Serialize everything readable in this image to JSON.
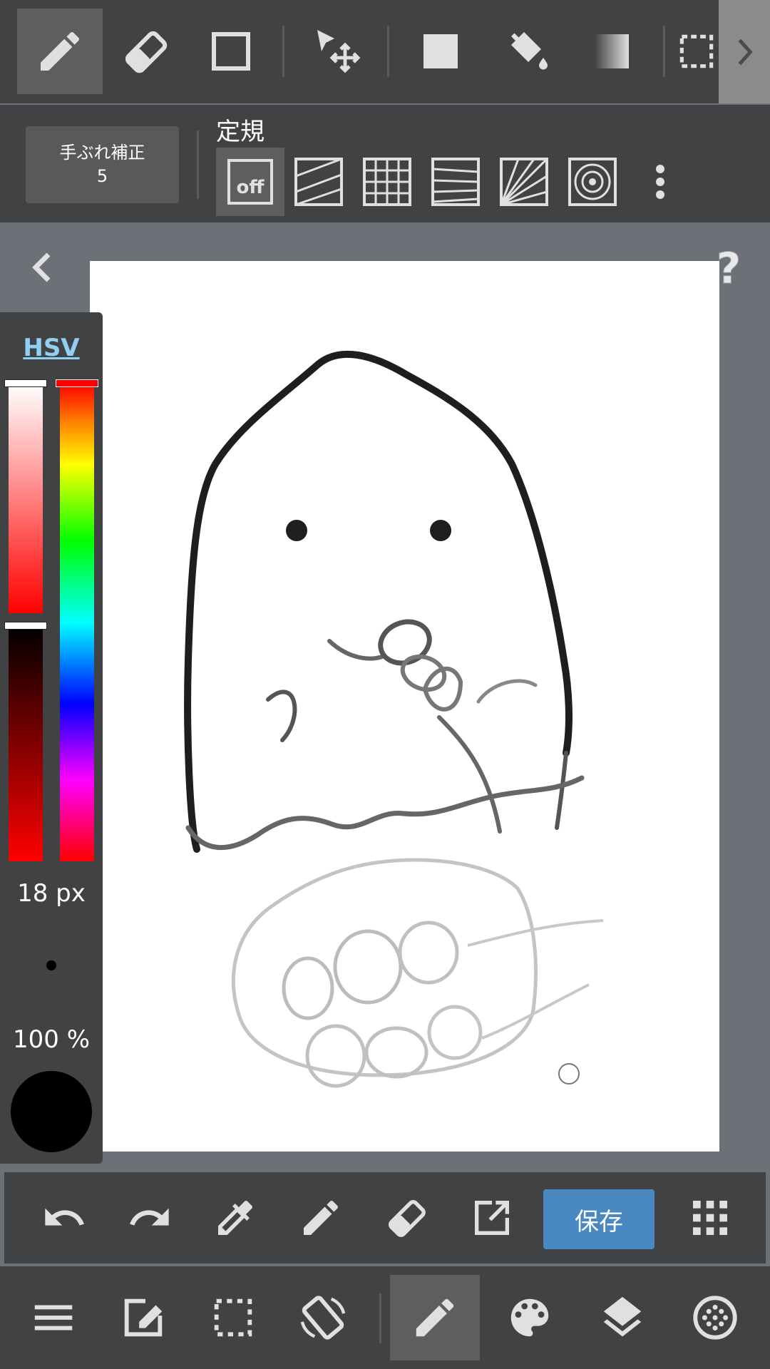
{
  "top_toolbar": {
    "tools": [
      {
        "name": "pen-tool",
        "icon": "pencil-icon",
        "active": true
      },
      {
        "name": "eraser-tool",
        "icon": "eraser-icon",
        "active": false
      },
      {
        "name": "shape-tool",
        "icon": "square-outline-icon",
        "active": false
      },
      {
        "name": "move-tool",
        "icon": "move-cursor-icon",
        "active": false
      },
      {
        "name": "fill-rect-tool",
        "icon": "filled-square-icon",
        "active": false
      },
      {
        "name": "bucket-tool",
        "icon": "paint-bucket-icon",
        "active": false
      },
      {
        "name": "gradient-tool",
        "icon": "gradient-icon",
        "active": false
      },
      {
        "name": "select-tool",
        "icon": "dashed-select-icon",
        "active": false
      }
    ]
  },
  "sub_toolbar": {
    "stabilizer_label": "手ぶれ補正",
    "stabilizer_value": "5",
    "ruler_title": "定規",
    "ruler_off_label": "off",
    "rulers": [
      "off",
      "parallel",
      "grid",
      "perspective",
      "radial",
      "concentric"
    ]
  },
  "color_panel": {
    "mode_label": "HSV",
    "brush_size": "18 px",
    "opacity": "100 %",
    "current_color": "#000000",
    "hue_color": "#ff0000"
  },
  "action_bar": {
    "save_label": "保存",
    "buttons": [
      "undo-icon",
      "redo-icon",
      "eyedropper-icon",
      "pencil-icon",
      "eraser-icon",
      "export-icon",
      "grid-menu-icon"
    ],
    "save_color": "#4a88c2"
  },
  "bottom_nav": {
    "items": [
      "menu-icon",
      "edit-icon",
      "selection-icon",
      "rotate-icon",
      "brush-icon",
      "palette-icon",
      "layers-icon",
      "material-icon"
    ],
    "active_item": "brush-icon"
  }
}
